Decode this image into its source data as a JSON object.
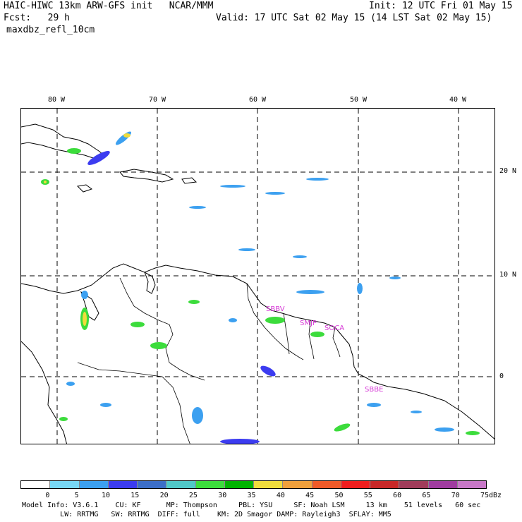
{
  "header": {
    "title": "HAIC-HIWC 13km ARW-GFS init   NCAR/MMM",
    "init": "Init: 12 UTC Fri 01 May 15",
    "fcst": "Fcst:   29 h",
    "valid": "Valid: 17 UTC Sat 02 May 15 (14 LST Sat 02 May 15)",
    "field": "maxdbz_refl_10cm"
  },
  "map": {
    "lon_labels": [
      "80 W",
      "70 W",
      "60 W",
      "50 W",
      "40 W"
    ],
    "lat_labels": [
      "20 N",
      "10 N",
      "0"
    ],
    "grid_style": "dashed",
    "station_labels": [
      "SBBV",
      "SMJP",
      "SOCA",
      "SBBE"
    ],
    "station_color": "#d63ad6"
  },
  "colorbar": {
    "ticks": [
      "0",
      "5",
      "10",
      "15",
      "20",
      "25",
      "30",
      "35",
      "40",
      "45",
      "50",
      "55",
      "60",
      "65",
      "70",
      "75"
    ],
    "unit": "dBz",
    "colors": [
      "#ffffff",
      "#78d8f5",
      "#3ca0f0",
      "#3c3cf0",
      "#3c6ec8",
      "#50c8c8",
      "#3cdc3c",
      "#00b400",
      "#f0dc3c",
      "#f0a03c",
      "#f05a28",
      "#f01e1e",
      "#c82828",
      "#a03c5a",
      "#a03ca0",
      "#c878c8"
    ]
  },
  "footer": {
    "line1": "Model Info: V3.6.1    CU: KF      MP: Thompson     PBL: YSU     SF: Noah LSM     13 km    51 levels   60 sec",
    "line2": "         LW: RRTMG   SW: RRTMG  DIFF: full    KM: 2D Smagor DAMP: Rayleigh3  SFLAY: MM5"
  }
}
